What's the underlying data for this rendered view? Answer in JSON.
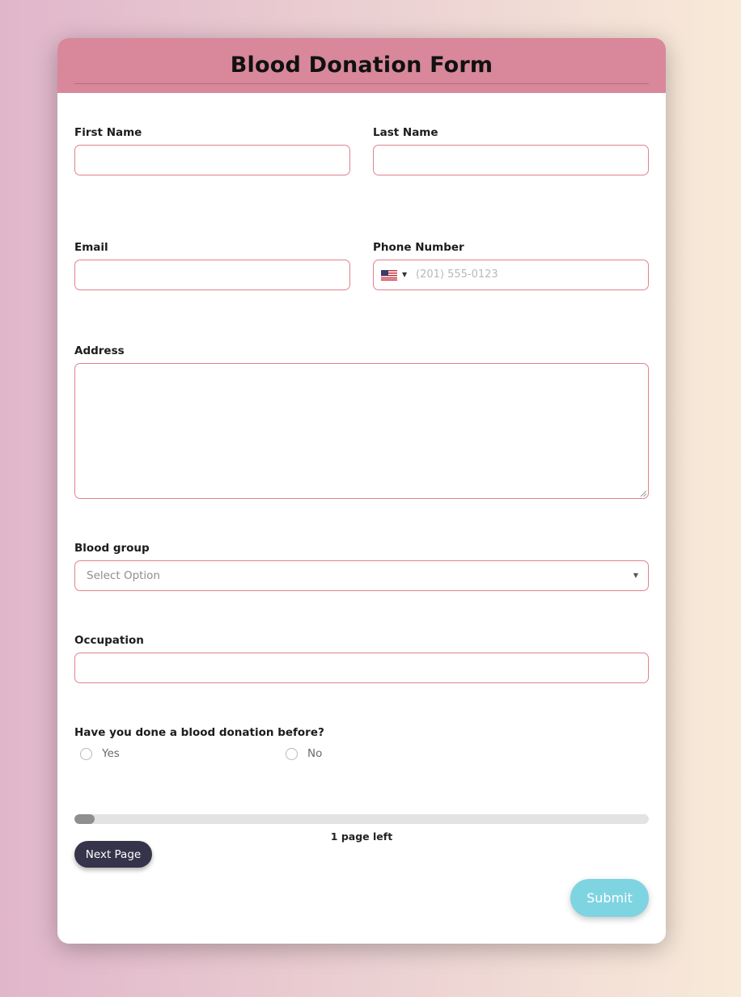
{
  "form": {
    "title": "Blood Donation Form",
    "first_name": {
      "label": "First Name",
      "value": ""
    },
    "last_name": {
      "label": "Last Name",
      "value": ""
    },
    "email": {
      "label": "Email",
      "value": ""
    },
    "phone": {
      "label": "Phone Number",
      "placeholder": "(201) 555-0123",
      "country_flag": "us-flag-icon"
    },
    "address": {
      "label": "Address",
      "value": ""
    },
    "blood_group": {
      "label": "Blood group",
      "selected": "Select Option"
    },
    "occupation": {
      "label": "Occupation",
      "value": ""
    },
    "donated_before": {
      "question": "Have you done a blood donation before?",
      "options": [
        "Yes",
        "No"
      ],
      "selected": null
    }
  },
  "progress": {
    "fraction": 0.035,
    "text": "1 page left"
  },
  "buttons": {
    "next": "Next Page",
    "submit": "Submit"
  },
  "colors": {
    "header": "#d8889a",
    "field_border": "#e0828f",
    "next_button": "#35344a",
    "submit_button": "#7fd4e2"
  }
}
